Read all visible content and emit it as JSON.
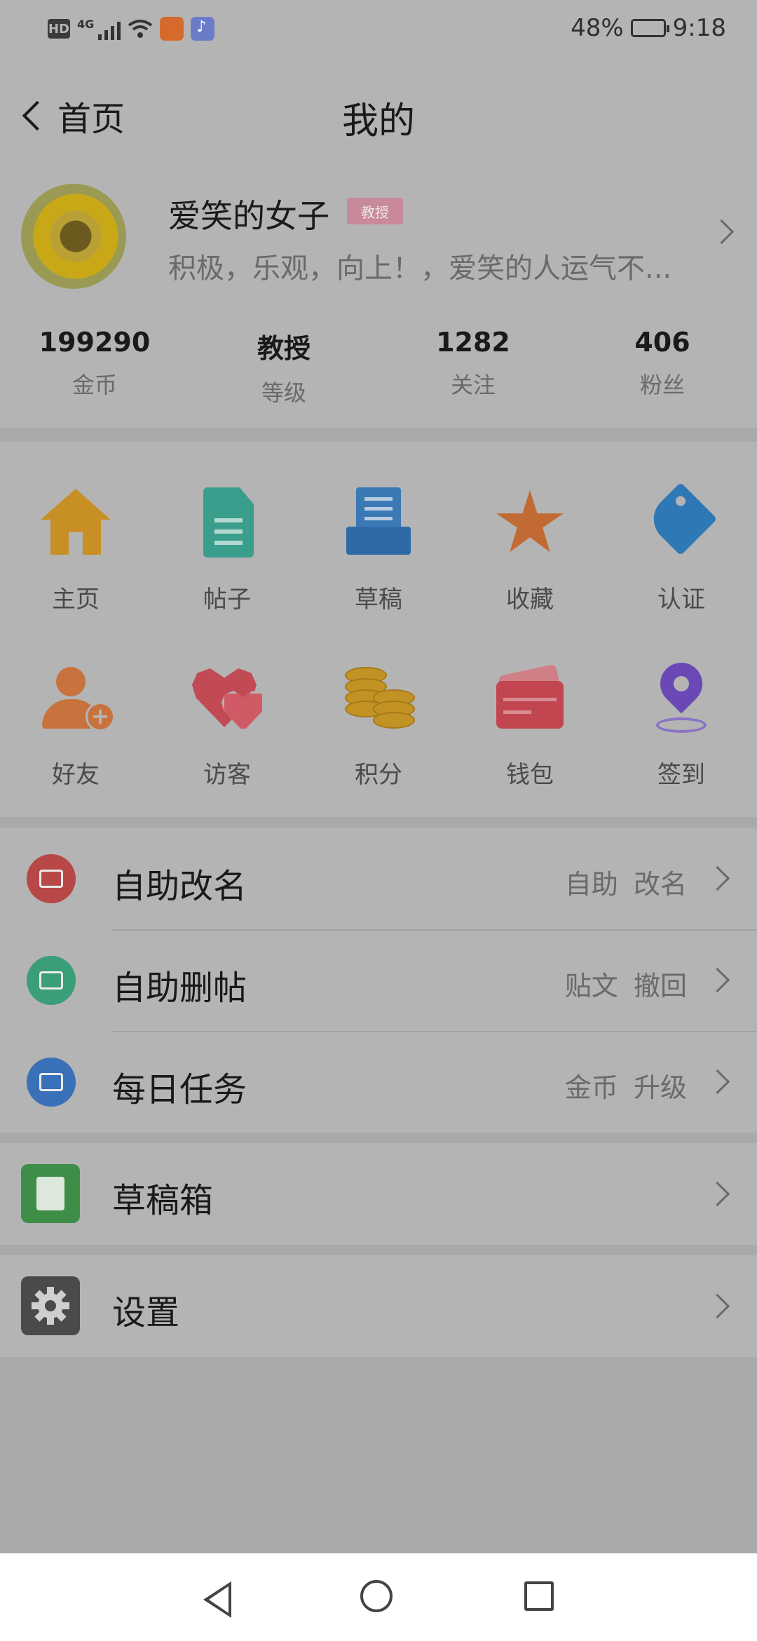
{
  "status_bar": {
    "hd": "HD",
    "network": "4G",
    "battery": "48%",
    "time": "9:18"
  },
  "header": {
    "back_label": "首页",
    "title": "我的"
  },
  "profile": {
    "name": "爱笑的女子",
    "badge": "教授",
    "signature": "积极，乐观，向上！，爱笑的人运气不...",
    "stats": [
      {
        "value": "199290",
        "label": "金币"
      },
      {
        "value": "教授",
        "label": "等级"
      },
      {
        "value": "1282",
        "label": "关注"
      },
      {
        "value": "406",
        "label": "粉丝"
      }
    ]
  },
  "grid": {
    "row1": [
      {
        "label": "主页",
        "icon": "home-icon",
        "color": "#c89024"
      },
      {
        "label": "帖子",
        "icon": "document-icon",
        "color": "#3a9e8c"
      },
      {
        "label": "草稿",
        "icon": "draft-tray-icon",
        "color": "#3a78b6"
      },
      {
        "label": "收藏",
        "icon": "star-icon",
        "color": "#c26a34"
      },
      {
        "label": "认证",
        "icon": "tag-icon",
        "color": "#2f78b6"
      }
    ],
    "row2": [
      {
        "label": "好友",
        "icon": "add-friend-icon",
        "color": "#c8733e"
      },
      {
        "label": "访客",
        "icon": "hearts-icon",
        "color": "#c24a54"
      },
      {
        "label": "积分",
        "icon": "coins-icon",
        "color": "#c29224"
      },
      {
        "label": "钱包",
        "icon": "wallet-icon",
        "color": "#c24650"
      },
      {
        "label": "签到",
        "icon": "location-pin-icon",
        "color": "#6a48b6"
      }
    ]
  },
  "list": [
    {
      "name": "自助改名",
      "right": "自助 改名",
      "icon": "card-icon",
      "color": "#b84848"
    },
    {
      "name": "自助删帖",
      "right": "贴文 撤回",
      "icon": "book-icon",
      "color": "#3a9e78"
    },
    {
      "name": "每日任务",
      "right": "金币 升级",
      "icon": "bar-chart-icon",
      "color": "#3a70b8"
    }
  ],
  "cards": [
    {
      "name": "草稿箱",
      "icon": "note-icon",
      "color": "#3e8e48"
    },
    {
      "name": "设置",
      "icon": "gear-icon",
      "color": "#4a4a4a"
    }
  ]
}
